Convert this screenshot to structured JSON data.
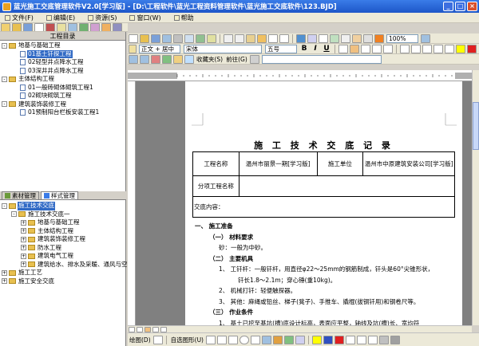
{
  "title": "蓝光施工交底管理软件V2.0[学习版] - [D:\\工程软件\\蓝光工程资料管理软件\\蓝光施工交底软件\\123.BJD]",
  "menu": [
    "文件(F)",
    "编辑(E)",
    "资源(S)",
    "窗口(W)",
    "帮助"
  ],
  "format_bar": {
    "style": "正文 + 居中",
    "font": "宋体",
    "size": "五号",
    "bold": "B",
    "italic": "I",
    "underline": "U",
    "zoom": "100%"
  },
  "bar3": {
    "favorites": "收藏夹(S)",
    "back": "前往(G)"
  },
  "left_header": "工程目录",
  "tree1": [
    {
      "label": "地基与基础工程",
      "level": 0,
      "kind": "folder",
      "exp": "-"
    },
    {
      "label": "01基土钎探工程",
      "level": 1,
      "kind": "doc",
      "selected": true
    },
    {
      "label": "02轻型井点降水工程",
      "level": 1,
      "kind": "doc"
    },
    {
      "label": "03深井井点降水工程",
      "level": 1,
      "kind": "doc"
    },
    {
      "label": "主体结构工程",
      "level": 0,
      "kind": "folder",
      "exp": "-"
    },
    {
      "label": "01一般砖砌体砌筑工程1",
      "level": 1,
      "kind": "doc"
    },
    {
      "label": "02砌块砌筑工程",
      "level": 1,
      "kind": "doc"
    },
    {
      "label": "建筑装饰装修工程",
      "level": 0,
      "kind": "folder",
      "exp": "-"
    },
    {
      "label": "01预制阳台栏板安装工程1",
      "level": 1,
      "kind": "doc"
    }
  ],
  "tabs": [
    "素材管理",
    "样式管理"
  ],
  "tree2": [
    {
      "label": "施工技术交底",
      "level": 0,
      "exp": "-",
      "selected": true
    },
    {
      "label": "施工技术交底一",
      "level": 1,
      "exp": "-"
    },
    {
      "label": "地基与基础工程",
      "level": 2,
      "exp": "+"
    },
    {
      "label": "主体结构工程",
      "level": 2,
      "exp": "+"
    },
    {
      "label": "建筑装饰装修工程",
      "level": 2,
      "exp": "+"
    },
    {
      "label": "防水工程",
      "level": 2,
      "exp": "+"
    },
    {
      "label": "建筑电气工程",
      "level": 2,
      "exp": "+"
    },
    {
      "label": "建筑给水、排水及采暖、通风与空",
      "level": 2,
      "exp": "+"
    },
    {
      "label": "施工工艺",
      "level": 0,
      "exp": "+"
    },
    {
      "label": "施工安全交底",
      "level": 0,
      "exp": "+"
    }
  ],
  "document": {
    "title": "施 工 技 术 交 底 记 录",
    "table": {
      "project_name_label": "工程名称",
      "project_name": "温州市丽景一期[学习版]",
      "unit_label": "施工单位",
      "unit": "温州市中原建筑安装公司[学习版]",
      "sub_label": "分项工程名称"
    },
    "content_label": "交底内容：",
    "lines": [
      {
        "text": "一、    施工准备",
        "bold": true,
        "x": 12
      },
      {
        "text": "（一）  材料要求",
        "bold": true,
        "x": 30
      },
      {
        "text": "砂：一般为中砂。",
        "bold": false,
        "x": 42
      },
      {
        "text": "（二）  主要机具",
        "bold": true,
        "x": 30
      },
      {
        "text": "1、    工钎杆：一般钎杆，用直径φ22～25mm的钢筋制成，钎头是60°尖锥形状，",
        "bold": false,
        "x": 42
      },
      {
        "text": "钎长1.8～2.1m；穿心锤(重10kg)。",
        "bold": false,
        "x": 66
      },
      {
        "text": "2、    机械打钎：轻便触探器。",
        "bold": false,
        "x": 42
      },
      {
        "text": "3、    其他：麻绳或铅丝、梯子(凳子)、手推车、撬棍(拔钢钎用)和钢卷尺等。",
        "bold": false,
        "x": 42
      },
      {
        "text": "（三）  作业条件",
        "bold": true,
        "x": 30
      },
      {
        "text": "1、    基土已挖至基坑(槽)底设计标高，表面应平整，轴线及坑(槽)长、宽均符",
        "bold": false,
        "x": 42
      }
    ]
  },
  "drawbar": {
    "draw": "绘图(D)",
    "autoshape": "自选图形(U)"
  }
}
